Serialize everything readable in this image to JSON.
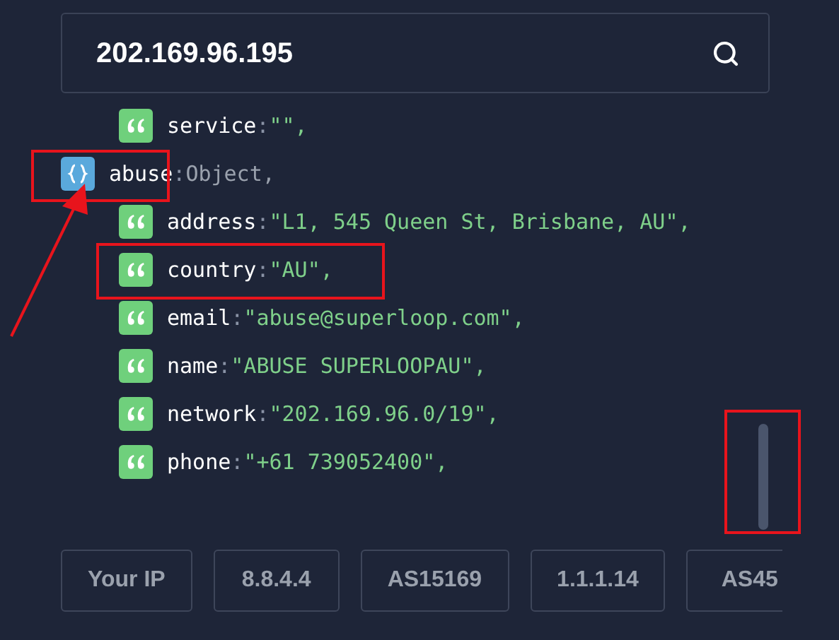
{
  "search": {
    "value": "202.169.96.195"
  },
  "entries": [
    {
      "kind": "continuation",
      "children": [
        {
          "kind": "string",
          "key": "service",
          "sep": ":",
          "value": "\"\","
        }
      ]
    },
    {
      "kind": "object",
      "key": "abuse",
      "sep": ":",
      "value": "Object,",
      "children": [
        {
          "kind": "string",
          "key": "address",
          "sep": ":",
          "value": "\"L1, 545 Queen St, Brisbane, AU\","
        },
        {
          "kind": "string",
          "key": "country",
          "sep": ":",
          "value": "\"AU\","
        },
        {
          "kind": "string",
          "key": "email",
          "sep": ":",
          "value": "\"abuse@superloop.com\","
        },
        {
          "kind": "string",
          "key": "name",
          "sep": ":",
          "value": "\"ABUSE SUPERLOOPAU\","
        },
        {
          "kind": "string",
          "key": "network",
          "sep": ":",
          "value": "\"202.169.96.0/19\","
        },
        {
          "kind": "string",
          "key": "phone",
          "sep": ":",
          "value": "\"+61 739052400\","
        }
      ]
    }
  ],
  "quick_buttons": [
    "Your IP",
    "8.8.4.4",
    "AS15169",
    "1.1.1.14",
    "AS45"
  ]
}
